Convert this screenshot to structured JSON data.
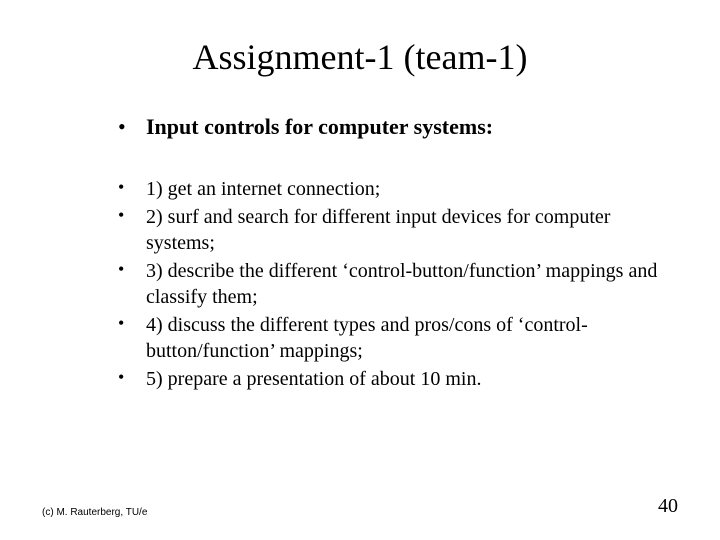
{
  "title": "Assignment-1 (team-1)",
  "main_bullet": "Input controls for computer systems:",
  "items": [
    "1) get an internet connection;",
    "2) surf and search for different input devices for computer systems;",
    "3) describe the different ‘control-button/function’ mappings and classify them;",
    "4) discuss the different types and pros/cons of ‘control-button/function’ mappings;",
    "5) prepare a presentation of about 10 min."
  ],
  "footer_left": "(c) M. Rauterberg, TU/e",
  "page_number": "40"
}
